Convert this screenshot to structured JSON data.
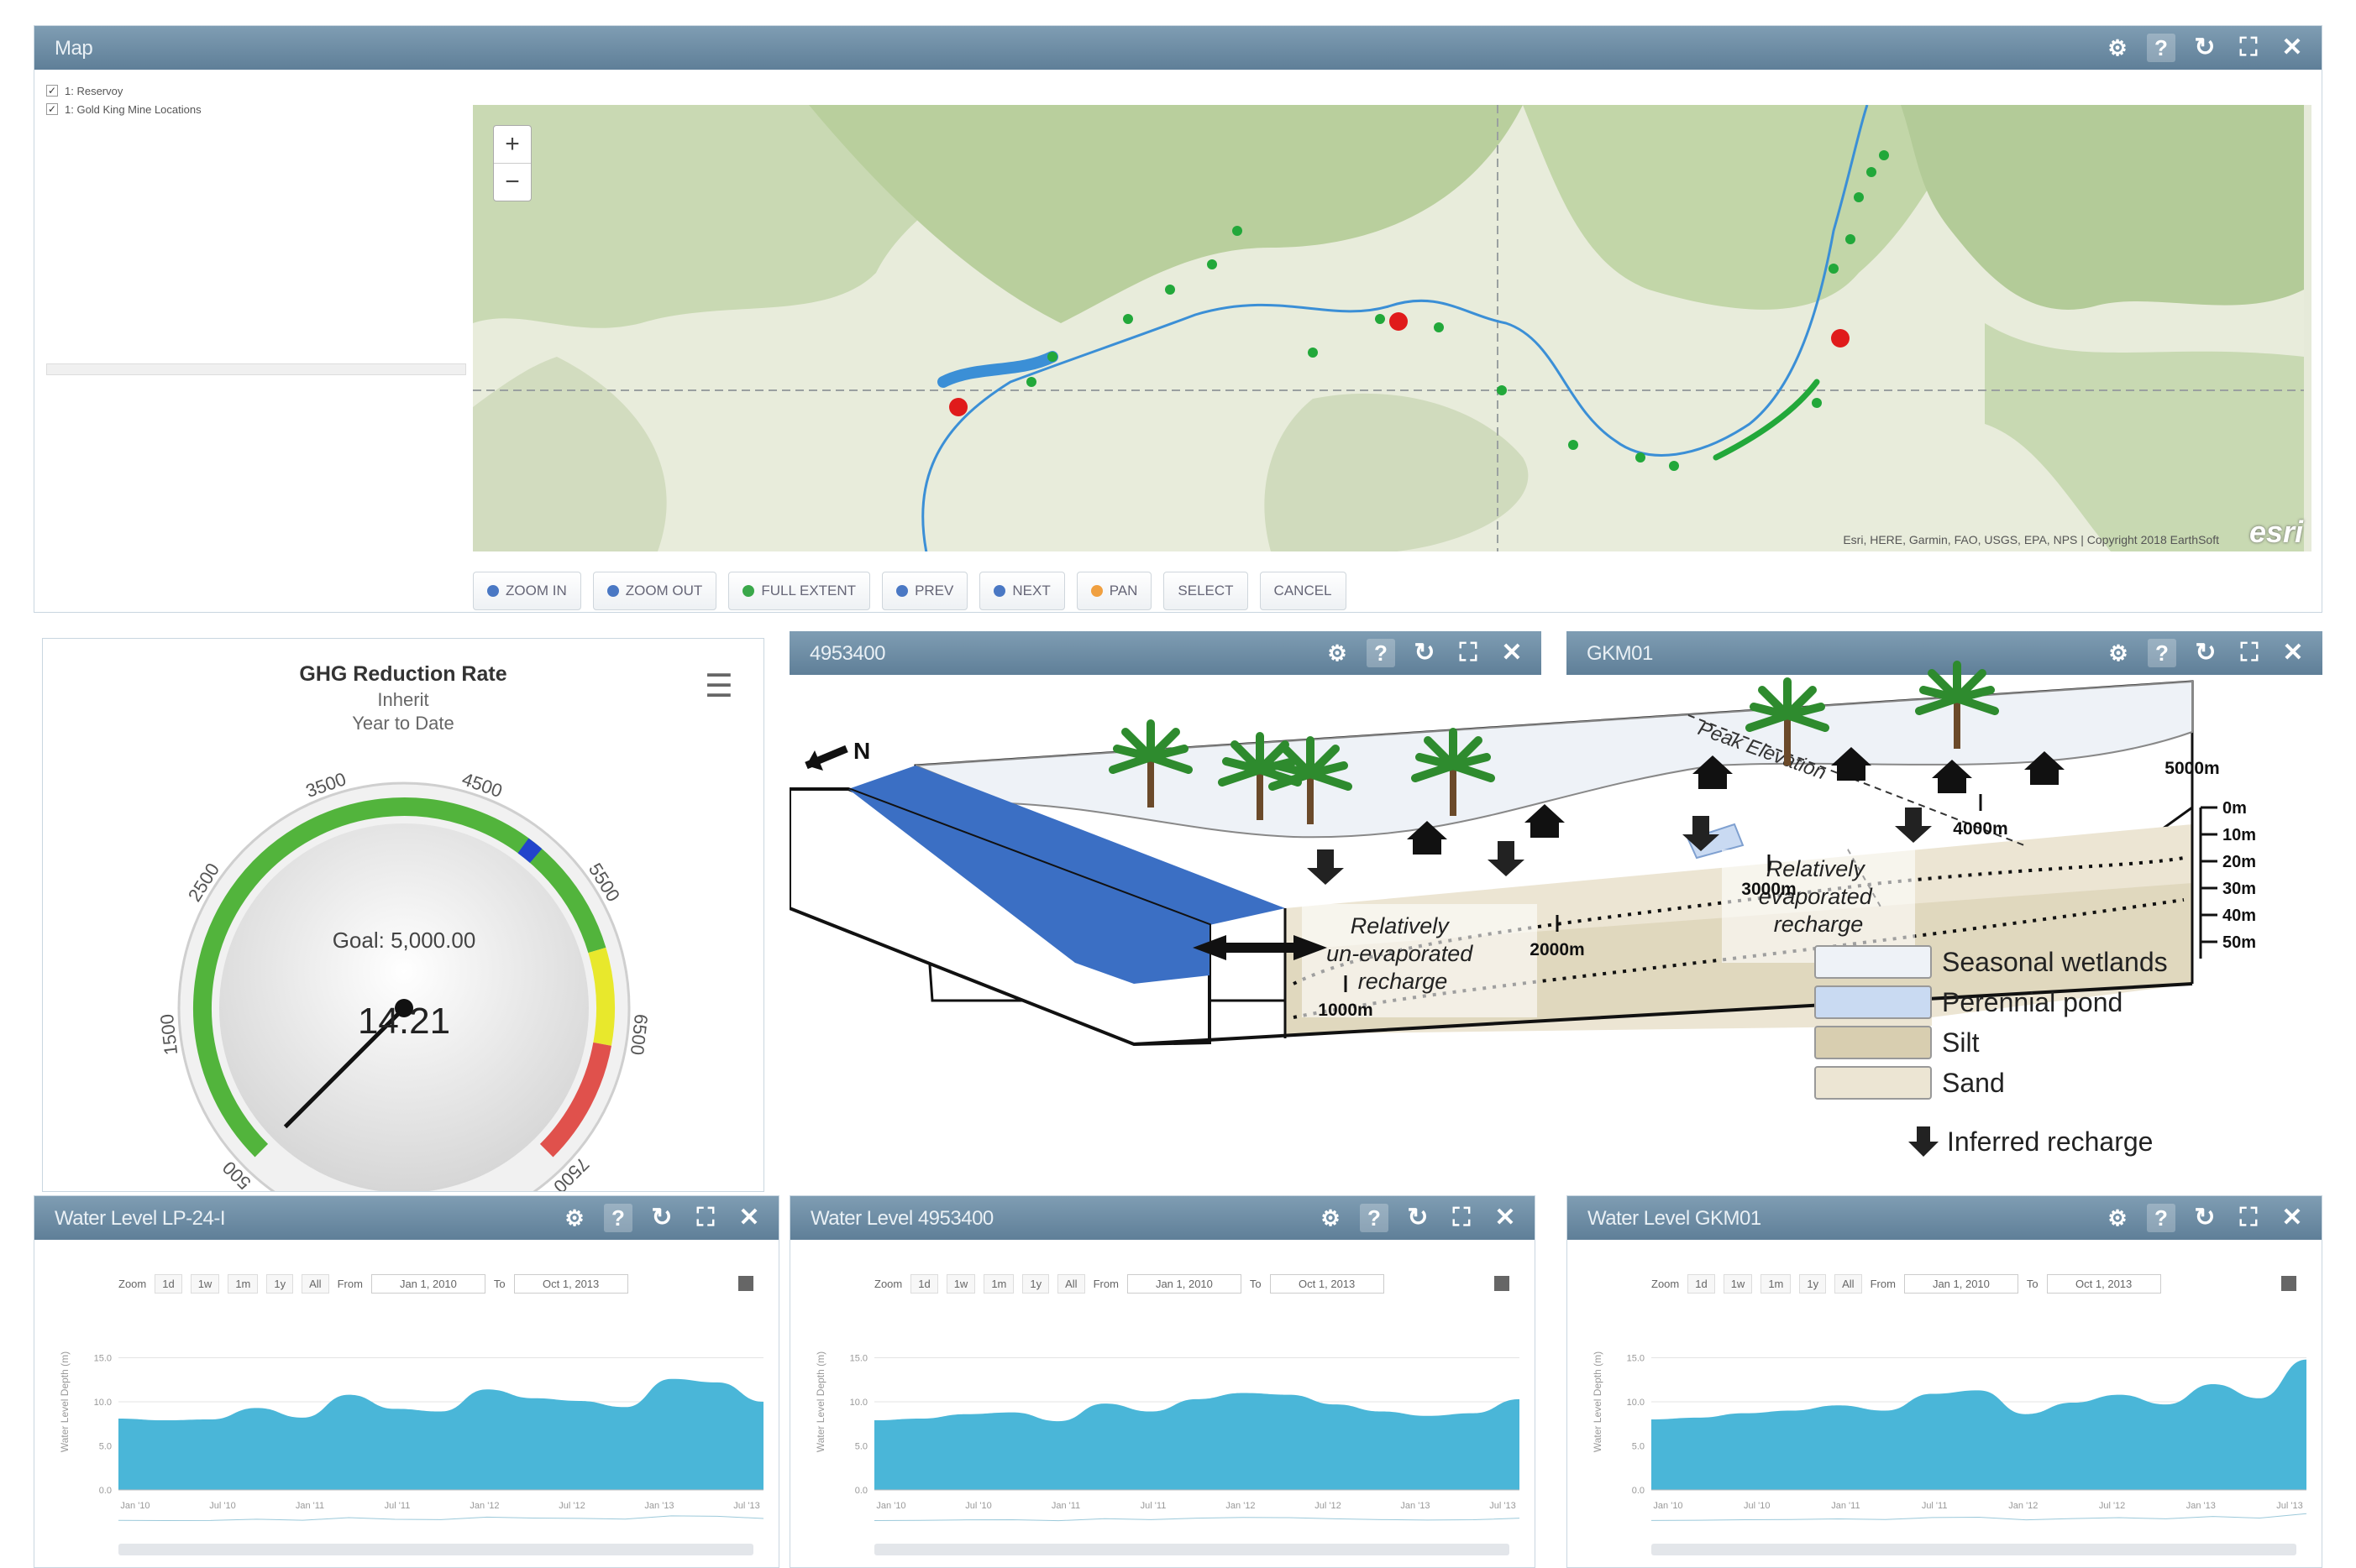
{
  "map_panel": {
    "title": "Map",
    "layers": [
      {
        "label": "1: Reservoy",
        "checked": true
      },
      {
        "label": "1: Gold King Mine Locations",
        "checked": true
      }
    ],
    "zoom_in_label": "+",
    "zoom_out_label": "−",
    "attribution": "Esri, HERE, Garmin, FAO, USGS, EPA, NPS | Copyright 2018 EarthSoft",
    "logo": "esri",
    "toolbar": [
      "ZOOM IN",
      "ZOOM OUT",
      "FULL EXTENT",
      "PREV",
      "NEXT",
      "PAN",
      "SELECT",
      "CANCEL"
    ],
    "colors": {
      "river": "#3b8fd6",
      "wells": "#22a83a",
      "sites": "#e01b1b",
      "terrain": "#e6ead9"
    }
  },
  "gauge_panel": {
    "title": "GHG Reduction Rate",
    "subtitle1": "Inherit",
    "subtitle2": "Year to Date",
    "goal_label": "Goal: 5,000.00",
    "value_label": "14.21",
    "value": 14.21,
    "min": 500,
    "max": 7500,
    "tick_labels": [
      "500",
      "1500",
      "2500",
      "3500",
      "4500",
      "5500",
      "6500",
      "7500"
    ],
    "goal": 5000,
    "bands": [
      {
        "from": 500,
        "to": 5900,
        "color": "#52b43c"
      },
      {
        "from": 5900,
        "to": 6600,
        "color": "#e8e82c"
      },
      {
        "from": 6600,
        "to": 7500,
        "color": "#e0514c"
      }
    ]
  },
  "diagram_panel": {
    "title": "4953400",
    "north": "N",
    "peak_label": "Peak Elevation",
    "left_annotation": [
      "Relatively",
      "un-evaporated",
      "recharge"
    ],
    "right_annotation": [
      "Relatively",
      "evaporated",
      "recharge"
    ],
    "depth_labels": [
      "0m",
      "10m",
      "20m",
      "30m",
      "40m",
      "50m"
    ],
    "distance_labels": [
      "1000m",
      "2000m",
      "3000m",
      "4000m",
      "5000m"
    ],
    "legend": [
      {
        "label": "Seasonal wetlands",
        "color": "#eef2f7"
      },
      {
        "label": "Perennial pond",
        "color": "#c9daf2"
      },
      {
        "label": "Silt",
        "color": "#d8ceb0"
      },
      {
        "label": "Sand",
        "color": "#ece5d3"
      }
    ],
    "recharge_label": "Inferred recharge"
  },
  "diagram_panel_right_title": "GKM01",
  "water_panels": [
    {
      "title": "Water Level LP-24-I",
      "values": [
        8.1,
        7.9,
        8.0,
        9.3,
        8.2,
        10.8,
        9.2,
        8.9,
        11.4,
        10.4,
        10.1,
        9.4,
        12.6,
        12.2,
        10.0
      ]
    },
    {
      "title": "Water Level 4953400",
      "values": [
        7.9,
        8.1,
        8.6,
        8.8,
        7.8,
        9.8,
        8.9,
        10.3,
        11.0,
        10.8,
        9.7,
        8.9,
        8.4,
        8.7,
        10.3
      ]
    },
    {
      "title": "Water Level GKM01",
      "values": [
        8.0,
        8.2,
        8.7,
        9.0,
        9.6,
        9.0,
        10.9,
        11.3,
        8.6,
        9.9,
        10.8,
        9.7,
        12.0,
        10.4,
        14.8
      ]
    }
  ],
  "water_controls": {
    "zoom_label": "Zoom",
    "zoom_buttons": [
      "1d",
      "1w",
      "1m",
      "1y",
      "All"
    ],
    "from_label": "From",
    "from_value": "Jan 1, 2010",
    "to_label": "To",
    "to_value": "Oct 1, 2013",
    "yaxis_label": "Water Level Depth (m)",
    "y_ticks": [
      "0.0",
      "5.0",
      "10.0",
      "15.0"
    ],
    "x_ticks": [
      "Jan '10",
      "Jul '10",
      "Jan '11",
      "Jul '11",
      "Jan '12",
      "Jul '12",
      "Jan '13",
      "Jul '13"
    ],
    "fill_color": "#4ab6d8"
  }
}
